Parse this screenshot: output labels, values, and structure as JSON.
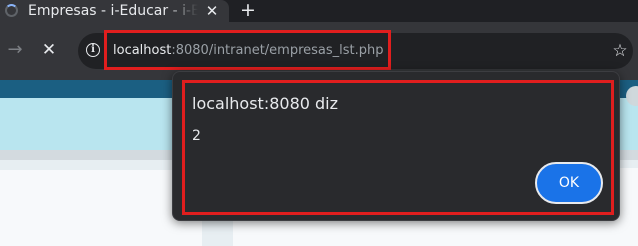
{
  "tab": {
    "title": "Empresas - i-Educar - i-Educar",
    "close_glyph": "✕",
    "new_tab_glyph": "+",
    "spinner_icon": "loading-spinner-icon"
  },
  "toolbar": {
    "back_glyph": "→",
    "stop_glyph": "✕",
    "info_glyph": "i",
    "star_glyph": "☆"
  },
  "url": {
    "host": "localhost",
    "rest": ":8080/intranet/empresas_lst.php"
  },
  "alert": {
    "title": "localhost:8080 diz",
    "message": "2",
    "ok_label": "OK"
  },
  "colors": {
    "highlight": "#e01e1e",
    "accent": "#1a73e8",
    "page_topbar": "#1b5f82",
    "page_banner": "#b9e5ef"
  }
}
